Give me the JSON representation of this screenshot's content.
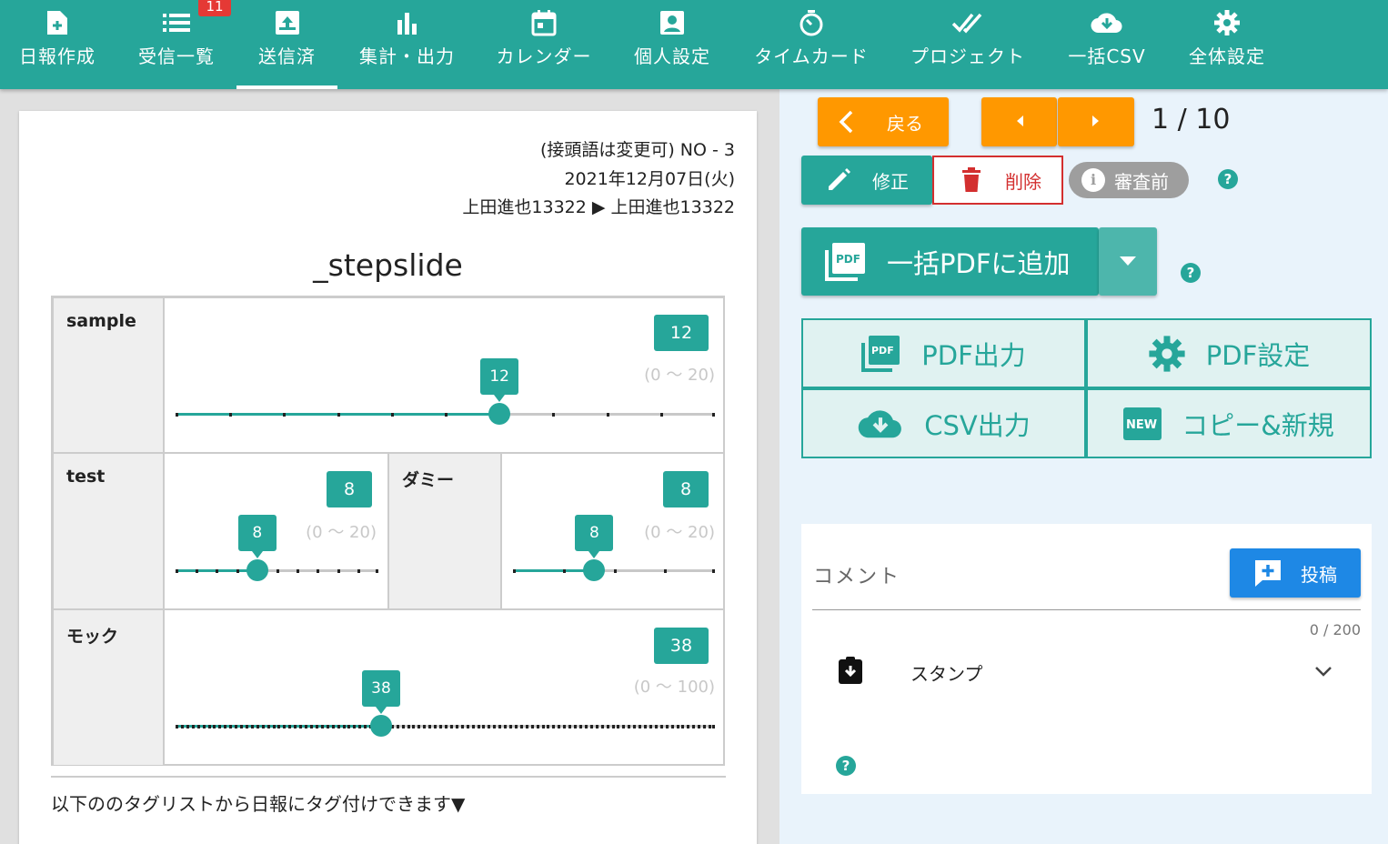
{
  "nav": {
    "badge": "11",
    "items": [
      {
        "label": "日報作成",
        "icon": "file-plus-icon"
      },
      {
        "label": "受信一覧",
        "icon": "list-icon"
      },
      {
        "label": "送信済",
        "icon": "outbox-icon"
      },
      {
        "label": "集計・出力",
        "icon": "bar-chart-icon"
      },
      {
        "label": "カレンダー",
        "icon": "calendar-icon"
      },
      {
        "label": "個人設定",
        "icon": "account-box-icon"
      },
      {
        "label": "タイムカード",
        "icon": "timer-icon"
      },
      {
        "label": "プロジェクト",
        "icon": "double-check-icon"
      },
      {
        "label": "一括CSV",
        "icon": "cloud-download-icon"
      },
      {
        "label": "全体設定",
        "icon": "gear-icon"
      }
    ]
  },
  "report": {
    "number": "(接頭語は変更可) NO - 3",
    "date": "2021年12月07日(火)",
    "route": "上田進也13322 ▶ 上田進也13322",
    "title": "_stepslide",
    "rows": [
      {
        "label": "sample",
        "value": "12",
        "range": "(0 〜 20)",
        "min": 0,
        "max": 20,
        "step": 2
      },
      {
        "label": "test",
        "value": "8",
        "range": "(0 〜 20)",
        "min": 0,
        "max": 20,
        "step": 2
      },
      {
        "label": "ダミー",
        "value": "8",
        "range": "(0 〜 20)",
        "min": 0,
        "max": 20,
        "step": 5
      },
      {
        "label": "モック",
        "value": "38",
        "range": "(0 〜 100)",
        "min": 0,
        "max": 100,
        "step": 1
      }
    ],
    "footnote": "以下ののタグリストから日報にタグ付けできます▼"
  },
  "actions": {
    "back": "戻る",
    "pager": "1 / 10",
    "edit": "修正",
    "delete": "削除",
    "status": "審査前",
    "bulk_pdf": "一括PDFに追加",
    "pdf_output": "PDF出力",
    "pdf_settings": "PDF設定",
    "csv_output": "CSV出力",
    "copy_new": "コピー&新規",
    "help": "?"
  },
  "comment": {
    "label": "コメント",
    "post": "投稿",
    "counter": "0 / 200",
    "stamp": "スタンプ"
  },
  "colors": {
    "primary": "#26a69a",
    "accent": "#ff9800",
    "danger": "#d32f2f",
    "post": "#1e88e5"
  }
}
